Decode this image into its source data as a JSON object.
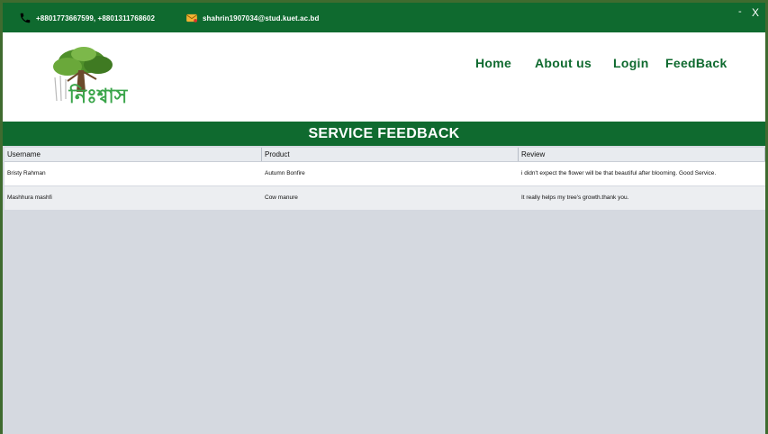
{
  "contact": {
    "phone": "+8801773667599, +8801311768602",
    "email": "shahrin1907034@stud.kuet.ac.bd"
  },
  "window": {
    "minimize": "-",
    "close": "X"
  },
  "logo": {
    "text": "নিঃশ্বাস"
  },
  "nav": {
    "home": "Home",
    "about": "About us",
    "login": "Login",
    "feedback": "FeedBack"
  },
  "banner": {
    "title": "SERVICE FEEDBACK"
  },
  "table": {
    "columns": [
      "Username",
      "Product",
      "Review"
    ],
    "rows": [
      {
        "username": "Bristy Rahman",
        "product": "Autumn Bonfire",
        "review": "i didn't expect the flower will be that beautiful after blooming. Good Service."
      },
      {
        "username": "Mashhura mashfi",
        "product": "Cow manure",
        "review": "It really helps my tree's growth.thank you."
      }
    ]
  },
  "colors": {
    "brand": "#0f6a2f",
    "grid_bg": "#d5d9e0",
    "row_alt": "#eceef1"
  }
}
